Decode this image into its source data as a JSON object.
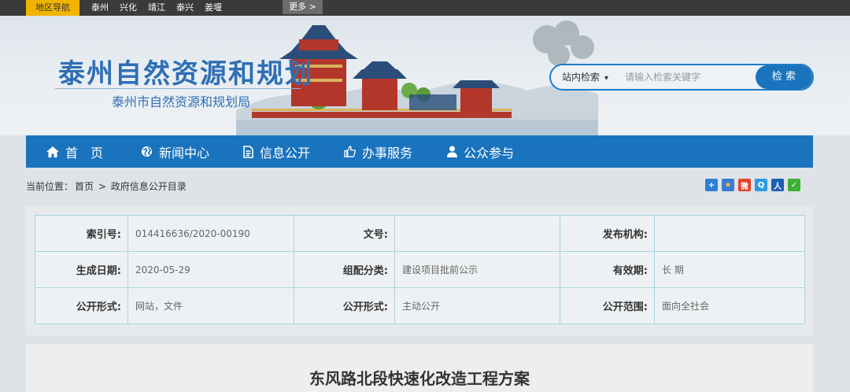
{
  "topbar": {
    "region_tab": "地区导航",
    "regions": [
      "泰州",
      "兴化",
      "靖江",
      "泰兴",
      "姜堰"
    ],
    "more": "更多 >"
  },
  "header": {
    "title": "泰州自然资源和规划",
    "subtitle": "泰州市自然资源和规划局"
  },
  "search": {
    "scope": "站内检索",
    "placeholder": "请输入检索关键字",
    "button": "检 索"
  },
  "nav": [
    {
      "label": "首　页",
      "icon": "home-icon"
    },
    {
      "label": "新闻中心",
      "icon": "globe-icon"
    },
    {
      "label": "信息公开",
      "icon": "document-icon"
    },
    {
      "label": "办事服务",
      "icon": "thumbs-up-icon"
    },
    {
      "label": "公众参与",
      "icon": "user-icon"
    }
  ],
  "breadcrumb": {
    "prefix": "当前位置：",
    "home": "首页",
    "sep": ">",
    "current": "政府信息公开目录"
  },
  "share_icons": [
    {
      "name": "plus-share-icon",
      "color": "#2d7fd2",
      "glyph": "+"
    },
    {
      "name": "star-share-icon",
      "color": "#3a7bd5",
      "glyph": "★"
    },
    {
      "name": "weibo-share-icon",
      "color": "#e2432a",
      "glyph": "微"
    },
    {
      "name": "qzone-share-icon",
      "color": "#2f9be0",
      "glyph": "Q"
    },
    {
      "name": "renren-share-icon",
      "color": "#1f5fb4",
      "glyph": "人"
    },
    {
      "name": "wechat-share-icon",
      "color": "#3bb034",
      "glyph": "✓"
    }
  ],
  "info": {
    "rows": [
      [
        {
          "label": "索引号:",
          "value": "014416636/2020-00190"
        },
        {
          "label": "文号:",
          "value": ""
        },
        {
          "label": "发布机构:",
          "value": ""
        }
      ],
      [
        {
          "label": "生成日期:",
          "value": "2020-05-29"
        },
        {
          "label": "组配分类:",
          "value": "建设项目批前公示"
        },
        {
          "label": "有效期:",
          "value": "长 期"
        }
      ],
      [
        {
          "label": "公开形式:",
          "value": "网站，文件"
        },
        {
          "label": "公开形式:",
          "value": "主动公开"
        },
        {
          "label": "公开范围:",
          "value": "面向全社会"
        }
      ]
    ]
  },
  "article": {
    "title": "东风路北段快速化改造工程方案"
  }
}
